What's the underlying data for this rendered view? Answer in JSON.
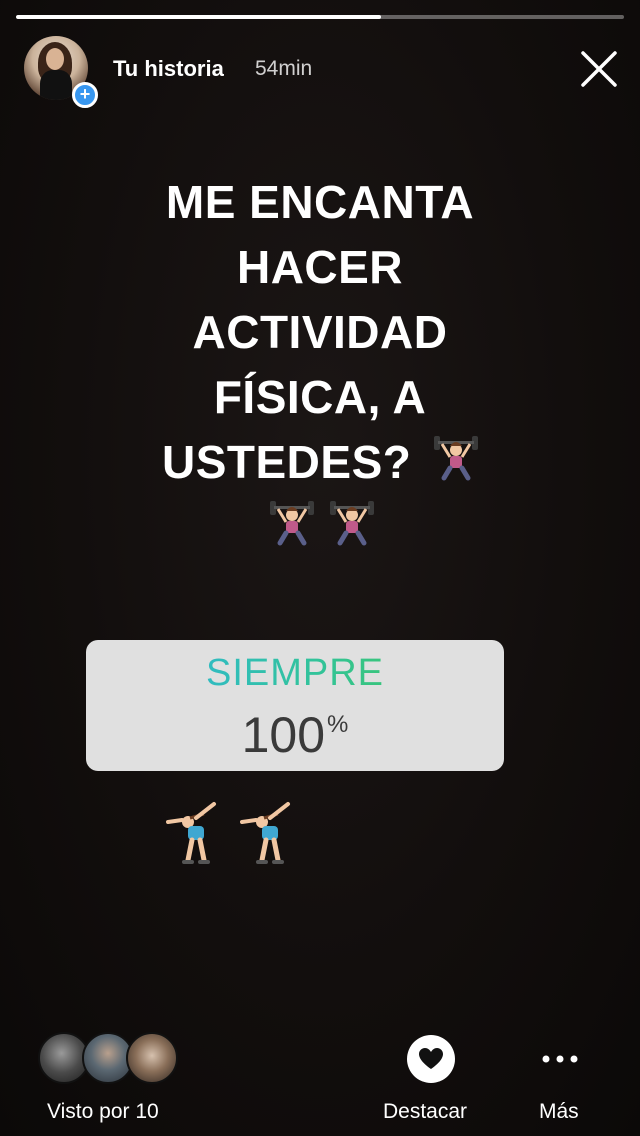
{
  "story": {
    "progress": 0.6
  },
  "header": {
    "username": "Tu historia",
    "time": "54min",
    "add_badge": "+",
    "close_icon": "close-icon"
  },
  "headline": {
    "lines": [
      "ME ENCANTA",
      "HACER",
      "ACTIVIDAD",
      "FÍSICA, A",
      "USTEDES?"
    ]
  },
  "stickers": {
    "weightlifter_icon": "weightlifter-emoji",
    "gymnast_icon": "cartwheel-emoji"
  },
  "poll": {
    "option": "SIEMPRE",
    "percent_value": "100",
    "percent_sign": "%",
    "gradient": [
      "#2fb4ea",
      "#32c39a",
      "#45c84a"
    ]
  },
  "footer": {
    "viewed_label": "Visto por 10",
    "highlight_label": "Destacar",
    "more_label": "Más"
  }
}
